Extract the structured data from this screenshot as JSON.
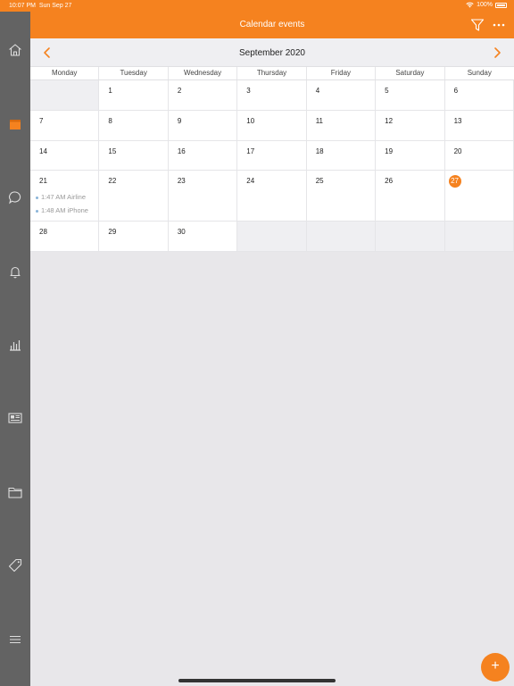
{
  "status": {
    "time": "10:07 PM",
    "date": "Sun Sep 27",
    "battery": "100%"
  },
  "nav": {
    "title": "Calendar events",
    "filter_icon": "filter-icon",
    "more_icon": "more-icon"
  },
  "sidebar": {
    "items": [
      {
        "icon": "home-icon"
      },
      {
        "icon": "calendar-icon",
        "active": true
      },
      {
        "icon": "chat-icon"
      },
      {
        "icon": "bell-icon"
      },
      {
        "icon": "bar-chart-icon"
      },
      {
        "icon": "news-icon"
      },
      {
        "icon": "folder-icon"
      },
      {
        "icon": "tag-icon"
      },
      {
        "icon": "menu-icon"
      }
    ]
  },
  "month": {
    "title": "September 2020",
    "prev_icon": "chevron-left-icon",
    "next_icon": "chevron-right-icon"
  },
  "weekdays": [
    "Monday",
    "Tuesday",
    "Wednesday",
    "Thursday",
    "Friday",
    "Saturday",
    "Sunday"
  ],
  "days": {
    "d1": "1",
    "d2": "2",
    "d3": "3",
    "d4": "4",
    "d5": "5",
    "d6": "6",
    "d7": "7",
    "d8": "8",
    "d9": "9",
    "d10": "10",
    "d11": "11",
    "d12": "12",
    "d13": "13",
    "d14": "14",
    "d15": "15",
    "d16": "16",
    "d17": "17",
    "d18": "18",
    "d19": "19",
    "d20": "20",
    "d21": "21",
    "d22": "22",
    "d23": "23",
    "d24": "24",
    "d25": "25",
    "d26": "26",
    "d27": "27",
    "d28": "28",
    "d29": "29",
    "d30": "30"
  },
  "today": "27",
  "events": [
    {
      "text": "1:47 AM Airline"
    },
    {
      "text": "1:48 AM iPhone"
    }
  ],
  "fab": {
    "label": "+"
  },
  "colors": {
    "accent": "#f5821f",
    "sidebar": "#636363",
    "background": "#e8e7ea"
  }
}
